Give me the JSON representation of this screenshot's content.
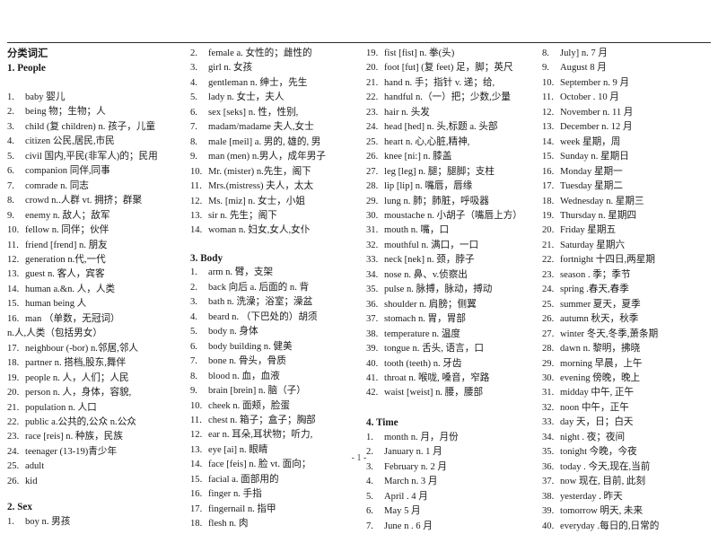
{
  "document": {
    "title": "分类词汇",
    "footer_page": "- 1 -"
  },
  "columns": [
    {
      "id": "column-1",
      "sections": [
        {
          "heading": "1. People",
          "entries": [
            {
              "num": "1.",
              "text": "baby   婴儿"
            },
            {
              "num": "2.",
              "text": "being  物；生物；人"
            },
            {
              "num": "3.",
              "text": "child (复 children) n. 孩子，儿童"
            },
            {
              "num": "4.",
              "text": "citizen   公民,居民,市民"
            },
            {
              "num": "5.",
              "text": "civil 国内,平民(非军人)的；民用"
            },
            {
              "num": "6.",
              "text": "companion  同伴,同事"
            },
            {
              "num": "7.",
              "text": "comrade  n. 同志"
            },
            {
              "num": "8.",
              "text": "crowd n..人群 vt. 拥挤；群聚"
            },
            {
              "num": "9.",
              "text": "enemy  n. 敌人；敌军"
            },
            {
              "num": "10.",
              "text": "fellow  n. 同伴；伙伴"
            },
            {
              "num": "11.",
              "text": "friend [frend] n.  朋友"
            },
            {
              "num": "12.",
              "text": "generation   n.代,一代"
            },
            {
              "num": "13.",
              "text": "guest   n. 客人，宾客"
            },
            {
              "num": "14.",
              "text": "human   a.&n. 人，人类"
            },
            {
              "num": "15.",
              "text": "human being  人"
            },
            {
              "num": "16.",
              "text": "man   （单数，无冠词）"
            }
          ],
          "continuation": "n.人,人类（包括男女）",
          "entries_after": [
            {
              "num": "17.",
              "text": "neighbour (-bor) n.邻居,邻人"
            },
            {
              "num": "18.",
              "text": "partner   n. 搭档,股东,舞伴"
            },
            {
              "num": "19.",
              "text": "people   n. 人，人们；人民"
            },
            {
              "num": "20.",
              "text": "person n. 人，身体，容貌,"
            },
            {
              "num": "21.",
              "text": "population   n. 人口"
            },
            {
              "num": "22.",
              "text": "public a.公共的,公众 n.公众"
            },
            {
              "num": "23.",
              "text": "race [reis] n. 种族，民族"
            },
            {
              "num": "24.",
              "text": "teenager   (13-19)青少年"
            },
            {
              "num": "25.",
              "text": "adult"
            },
            {
              "num": "26.",
              "text": "kid"
            }
          ]
        },
        {
          "heading": "2. Sex",
          "entries": [
            {
              "num": "1.",
              "text": "boy n. 男孩"
            }
          ]
        }
      ]
    },
    {
      "id": "column-2",
      "sections": [
        {
          "heading": null,
          "entries": [
            {
              "num": "2.",
              "text": "female   a. 女性的；雌性的"
            },
            {
              "num": "3.",
              "text": "girl   n. 女孩"
            },
            {
              "num": "4.",
              "text": "gentleman n. 绅士，先生"
            },
            {
              "num": "5.",
              "text": "lady n. 女士，夫人"
            },
            {
              "num": "6.",
              "text": "sex [seks] n. 性，性别,"
            },
            {
              "num": "7.",
              "text": "madam/madame 夫人,女士"
            },
            {
              "num": "8.",
              "text": "male [meil] a. 男的, 雄的, 男"
            },
            {
              "num": "9.",
              "text": "man   (men) n.男人，成年男子"
            },
            {
              "num": "10.",
              "text": "Mr.   (mister) n.先生，阁下"
            },
            {
              "num": "11.",
              "text": "Mrs.(mistress)  夫人，太太"
            },
            {
              "num": "12.",
              "text": "Ms. [miz] n. 女士，小姐"
            },
            {
              "num": "13.",
              "text": "sir n. 先生；阁下"
            },
            {
              "num": "14.",
              "text": "woman   n. 妇女,女人,女仆"
            }
          ]
        },
        {
          "heading": "3. Body",
          "entries": [
            {
              "num": "1.",
              "text": "arm   n. 臂，支架"
            },
            {
              "num": "2.",
              "text": "back   向后 a. 后面的 n. 背"
            },
            {
              "num": "3.",
              "text": "bath   n. 洗澡；浴室；澡盆"
            },
            {
              "num": "4.",
              "text": "beard n. （下巴处的）胡须"
            },
            {
              "num": "5.",
              "text": "body   n. 身体"
            },
            {
              "num": "6.",
              "text": "body building n. 健美"
            },
            {
              "num": "7.",
              "text": "bone   n. 骨头，骨质"
            },
            {
              "num": "8.",
              "text": "blood  n. 血，血液"
            },
            {
              "num": "9.",
              "text": "brain [brein] n. 脑（子）"
            },
            {
              "num": "10.",
              "text": "cheek n. 面颊，脸蛋"
            },
            {
              "num": "11.",
              "text": "chest n. 箱子；盒子；胸部"
            },
            {
              "num": "12.",
              "text": "ear   n. 耳朵,耳状物；听力,"
            },
            {
              "num": "13.",
              "text": "eye [ai] n. 眼睛"
            },
            {
              "num": "14.",
              "text": "face [feis] n. 脸  vt. 面向；"
            },
            {
              "num": "15.",
              "text": "facial a. 面部用的"
            },
            {
              "num": "16.",
              "text": "finger   n. 手指"
            },
            {
              "num": "17.",
              "text": "fingernail   n. 指甲"
            },
            {
              "num": "18.",
              "text": "flesh   n. 肉"
            }
          ]
        }
      ]
    },
    {
      "id": "column-3",
      "sections": [
        {
          "heading": null,
          "entries": [
            {
              "num": "19.",
              "text": "fist [fist] n. 拳(头)"
            },
            {
              "num": "20.",
              "text": "foot [fut] (复  feet) 足，脚；英尺"
            },
            {
              "num": "21.",
              "text": "hand n. 手；指针 v. 递；给,"
            },
            {
              "num": "22.",
              "text": "handful n.（一）把；少数,少量"
            },
            {
              "num": "23.",
              "text": "hair   n. 头发"
            },
            {
              "num": "24.",
              "text": "head [hed] n. 头,标题 a. 头部"
            },
            {
              "num": "25.",
              "text": "heart   n. 心,心脏,精神,"
            },
            {
              "num": "26.",
              "text": "knee [ni:] n. 膝盖"
            },
            {
              "num": "27.",
              "text": "leg [leg] n. 腿；腿脚；支柱"
            },
            {
              "num": "28.",
              "text": "lip [lip] n. 嘴唇，唇缘"
            },
            {
              "num": "29.",
              "text": "lung n. 肺；肺脏，呼吸器"
            },
            {
              "num": "30.",
              "text": "moustache n. 小胡子（嘴唇上方）"
            },
            {
              "num": "31.",
              "text": "mouth   n. 嘴，口"
            },
            {
              "num": "32.",
              "text": "mouthful   n. 满口，一口"
            },
            {
              "num": "33.",
              "text": "neck [nek] n. 颈，脖子"
            },
            {
              "num": "34.",
              "text": "nose n. 鼻、v.侦察出"
            },
            {
              "num": "35.",
              "text": "pulse   n. 脉搏，脉动，搏动"
            },
            {
              "num": "36.",
              "text": "shoulder   n. 肩膀；侧翼"
            },
            {
              "num": "37.",
              "text": "stomach   n. 胃，胃部"
            },
            {
              "num": "38.",
              "text": "temperature   n. 温度"
            },
            {
              "num": "39.",
              "text": "tongue n. 舌头, 语言，口"
            },
            {
              "num": "40.",
              "text": "tooth (teeth) n. 牙齿"
            },
            {
              "num": "41.",
              "text": "throat   n. 喉咙, 嗓音，窄路"
            },
            {
              "num": "42.",
              "text": "waist [weist] n. 腰，腰部"
            }
          ]
        },
        {
          "heading": "4.  Time",
          "entries": [
            {
              "num": "1.",
              "text": "month n. 月，月份"
            },
            {
              "num": "2.",
              "text": "January n. 1 月"
            },
            {
              "num": "3.",
              "text": "February   n. 2 月"
            },
            {
              "num": "4.",
              "text": "March n. 3 月"
            },
            {
              "num": "5.",
              "text": "April    . 4 月"
            },
            {
              "num": "6.",
              "text": "May      5 月"
            },
            {
              "num": "7.",
              "text": "June   n . 6 月"
            }
          ]
        }
      ]
    },
    {
      "id": "column-4",
      "sections": [
        {
          "heading": null,
          "entries": [
            {
              "num": "8.",
              "text": "July] n. 7 月"
            },
            {
              "num": "9.",
              "text": "August          8 月"
            },
            {
              "num": "10.",
              "text": "September n. 9 月"
            },
            {
              "num": "11.",
              "text": "October    . 10 月"
            },
            {
              "num": "12.",
              "text": "November   n. 11 月"
            },
            {
              "num": "13.",
              "text": "December n. 12 月"
            },
            {
              "num": "14.",
              "text": "week       星期，周"
            },
            {
              "num": "15.",
              "text": "Sunday   n. 星期日"
            },
            {
              "num": "16.",
              "text": "Monday         星期一"
            },
            {
              "num": "17.",
              "text": "Tuesday         星期二"
            },
            {
              "num": "18.",
              "text": "Wednesday n. 星期三"
            },
            {
              "num": "19.",
              "text": "Thursday n. 星期四"
            },
            {
              "num": "20.",
              "text": "Friday     星期五"
            },
            {
              "num": "21.",
              "text": "Saturday         星期六"
            },
            {
              "num": "22.",
              "text": "fortnight    十四日,两星期"
            },
            {
              "num": "23.",
              "text": "season      . 季；季节"
            },
            {
              "num": "24.",
              "text": "spring     .春天,春季"
            },
            {
              "num": "25.",
              "text": "summer      夏天，夏季"
            },
            {
              "num": "26.",
              "text": "autumn      秋天，秋季"
            },
            {
              "num": "27.",
              "text": "winter    冬天,冬季,萧条期"
            },
            {
              "num": "28.",
              "text": "dawn n. 黎明，拂晓"
            },
            {
              "num": "29.",
              "text": "morning       早晨，上午"
            },
            {
              "num": "30.",
              "text": "evening       傍晚，晚上"
            },
            {
              "num": "31.",
              "text": "midday    中午, 正午"
            },
            {
              "num": "32.",
              "text": "noon     中午，正午"
            },
            {
              "num": "33.",
              "text": "day        天，日；白天"
            },
            {
              "num": "34.",
              "text": "night      . 夜；夜间"
            },
            {
              "num": "35.",
              "text": "tonight   今晚，今夜"
            },
            {
              "num": "36.",
              "text": "today .   今天,现在,当前"
            },
            {
              "num": "37.",
              "text": "now      现在, 目前, 此刻"
            },
            {
              "num": "38.",
              "text": "yesterday . 昨天"
            },
            {
              "num": "39.",
              "text": "tomorrow  明天, 未来"
            },
            {
              "num": "40.",
              "text": "everyday .每日的,日常的"
            }
          ]
        }
      ]
    }
  ]
}
